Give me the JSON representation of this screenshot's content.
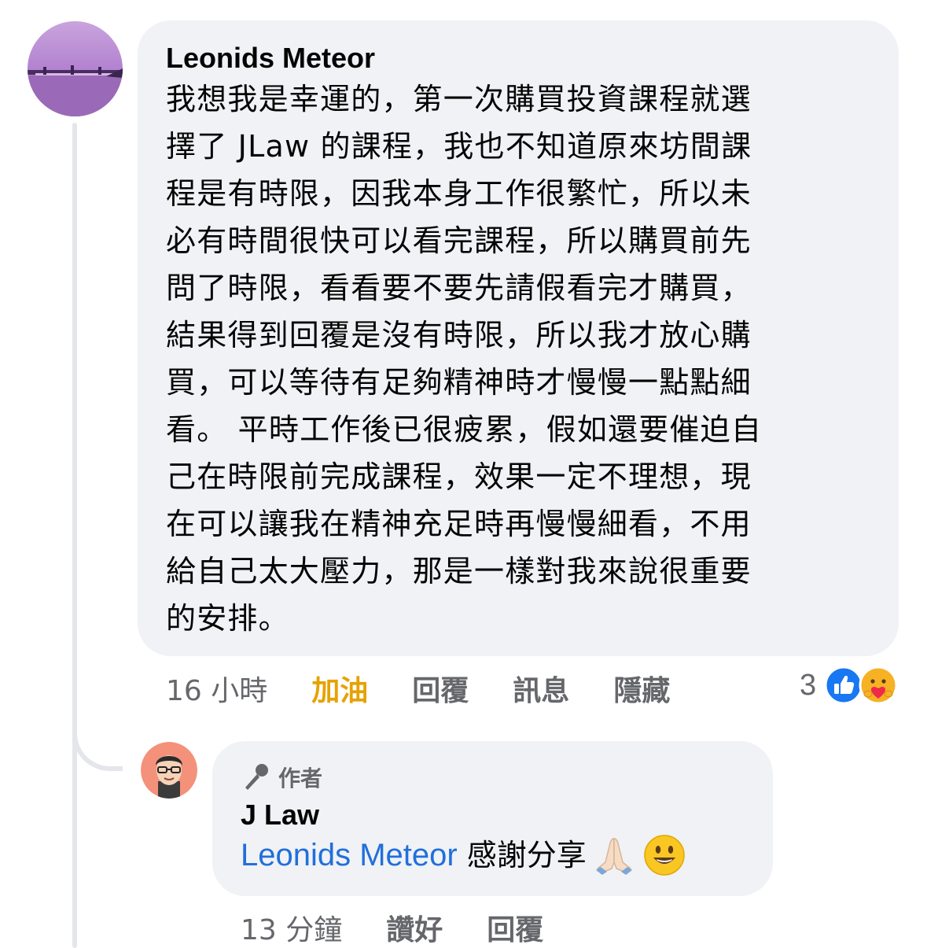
{
  "comment": {
    "author": "Leonids Meteor",
    "lines": [
      "我想我是幸運的，第一次購買投資課程就選",
      "擇了 JLaw 的課程，我也不知道原來坊間課",
      "程是有時限，因我本身工作很繁忙，所以未",
      "必有時間很快可以看完課程，所以購買前先",
      "問了時限，看看要不要先請假看完才購買，",
      "結果得到回覆是沒有時限，所以我才放心購",
      "買，可以等待有足夠精神時才慢慢一點點細",
      "看。  平時工作後已很疲累，假如還要催迫自",
      "己在時限前完成課程，效果一定不理想，現",
      "在可以讓我在精神充足時再慢慢細看，不用",
      "給自己太大壓力，那是一樣對我來說很重要",
      "的安排。"
    ],
    "time": "16 小時",
    "actions": [
      "加油",
      "回覆",
      "訊息",
      "隱藏"
    ],
    "reaction_count": "3",
    "reactions": [
      "like-icon",
      "care-icon"
    ]
  },
  "reply": {
    "badge": "作者",
    "author": "J Law",
    "mention": "Leonids Meteor",
    "text": "感謝分享",
    "emojis": [
      "folded-hands-emoji",
      "smiley-emoji"
    ],
    "time": "13 分鐘",
    "actions": [
      "讚好",
      "回覆"
    ]
  },
  "colors": {
    "bubble": "#f0f2f5",
    "meta": "#65676b",
    "mention": "#216fdb",
    "cheer": "#e5a200",
    "like": "#1877f2"
  }
}
